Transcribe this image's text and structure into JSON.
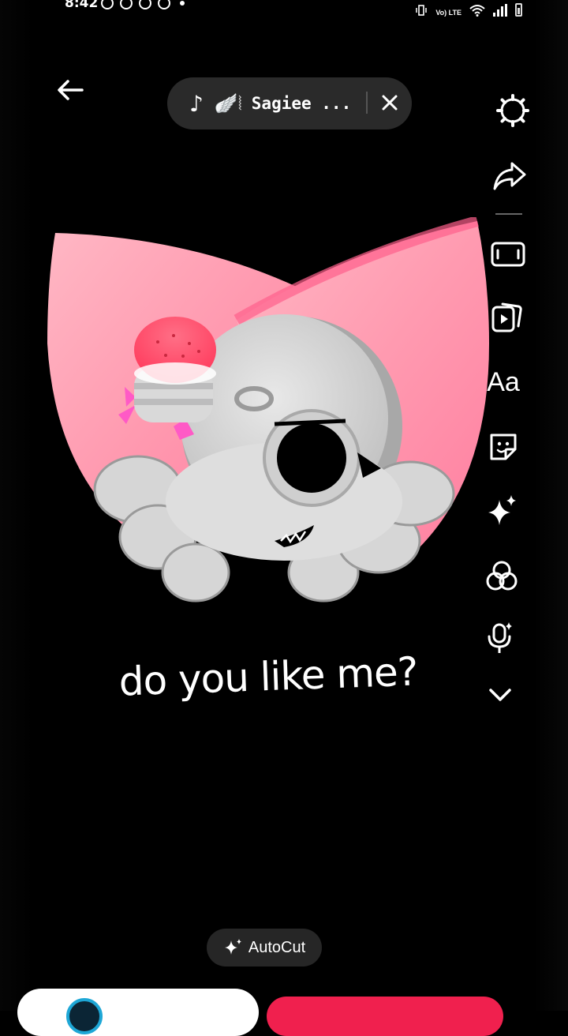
{
  "status_bar": {
    "time": "8:42",
    "network_label": "Vo) LTE"
  },
  "music": {
    "note_icon": "music-note-icon",
    "decor": "🪽⦚",
    "title": "Sagiee ..."
  },
  "caption": "do you like me?",
  "rail": {
    "text_label": "Aa",
    "icons": [
      "gear-icon",
      "share-icon",
      "aspect-ratio-icon",
      "templates-icon",
      "text-icon",
      "sticker-icon",
      "effects-sparkle-icon",
      "filters-icon",
      "voice-effect-icon",
      "chevron-down-icon"
    ]
  },
  "autocut": {
    "label": "AutoCut"
  },
  "colors": {
    "accent_red": "#f0204e",
    "pill_bg": "#2a2a2a",
    "ring_blue": "#1ea7d6"
  }
}
